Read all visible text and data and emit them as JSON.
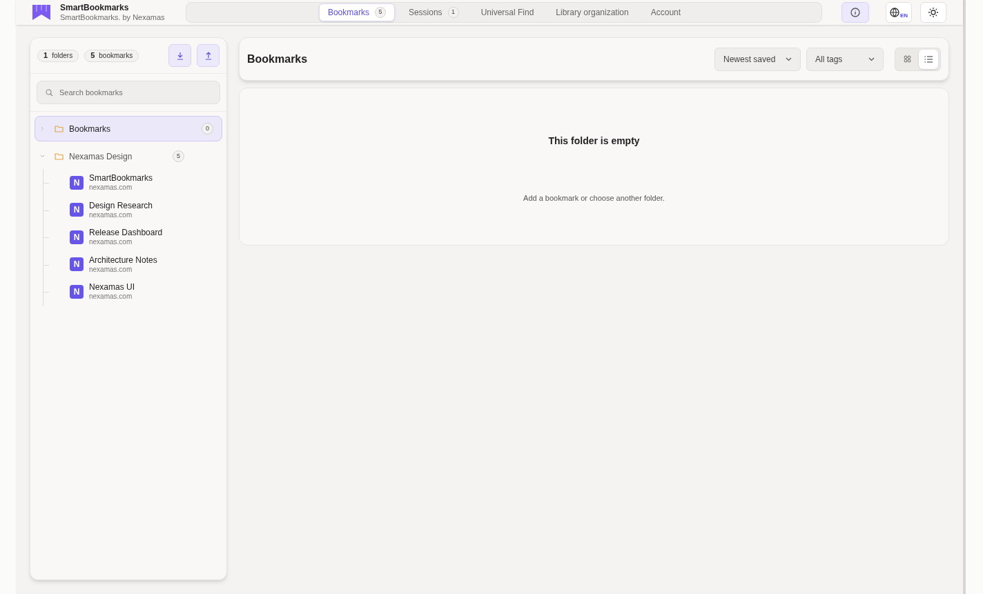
{
  "app": {
    "title": "SmartBookmarks",
    "subtitle": "SmartBookmarks. by Nexamas"
  },
  "nav_tabs": [
    {
      "label": "Bookmarks",
      "count": "5",
      "selected": true
    },
    {
      "label": "Sessions",
      "count": "1",
      "selected": false
    },
    {
      "label": "Universal Find",
      "selected": false
    },
    {
      "label": "Library organization",
      "selected": false
    },
    {
      "label": "Account",
      "selected": false
    }
  ],
  "language_badge": "EN",
  "sidebar": {
    "stats": [
      {
        "value": "1",
        "label": "folders"
      },
      {
        "value": "5",
        "label": "bookmarks"
      }
    ],
    "search": {
      "placeholder": "Search bookmarks"
    },
    "folders": [
      {
        "name": "Bookmarks",
        "count": "0",
        "selected": true,
        "expanded": false
      },
      {
        "name": "Nexamas Design",
        "count": "5",
        "selected": false,
        "expanded": true,
        "children": [
          {
            "icon_letter": "N",
            "title": "SmartBookmarks",
            "domain": "nexamas.com"
          },
          {
            "icon_letter": "N",
            "title": "Design Research",
            "domain": "nexamas.com"
          },
          {
            "icon_letter": "N",
            "title": "Release Dashboard",
            "domain": "nexamas.com"
          },
          {
            "icon_letter": "N",
            "title": "Architecture Notes",
            "domain": "nexamas.com"
          },
          {
            "icon_letter": "N",
            "title": "Nexamas UI",
            "domain": "nexamas.com"
          }
        ]
      }
    ]
  },
  "main": {
    "title": "Bookmarks",
    "sort": "Newest saved",
    "tag_filter": "All tags",
    "view_modes": [
      {
        "kind": "grid",
        "selected": false
      },
      {
        "kind": "list",
        "selected": true
      }
    ],
    "empty_state": {
      "title": "This folder is empty",
      "message": "Add a bookmark or choose another folder."
    }
  }
}
